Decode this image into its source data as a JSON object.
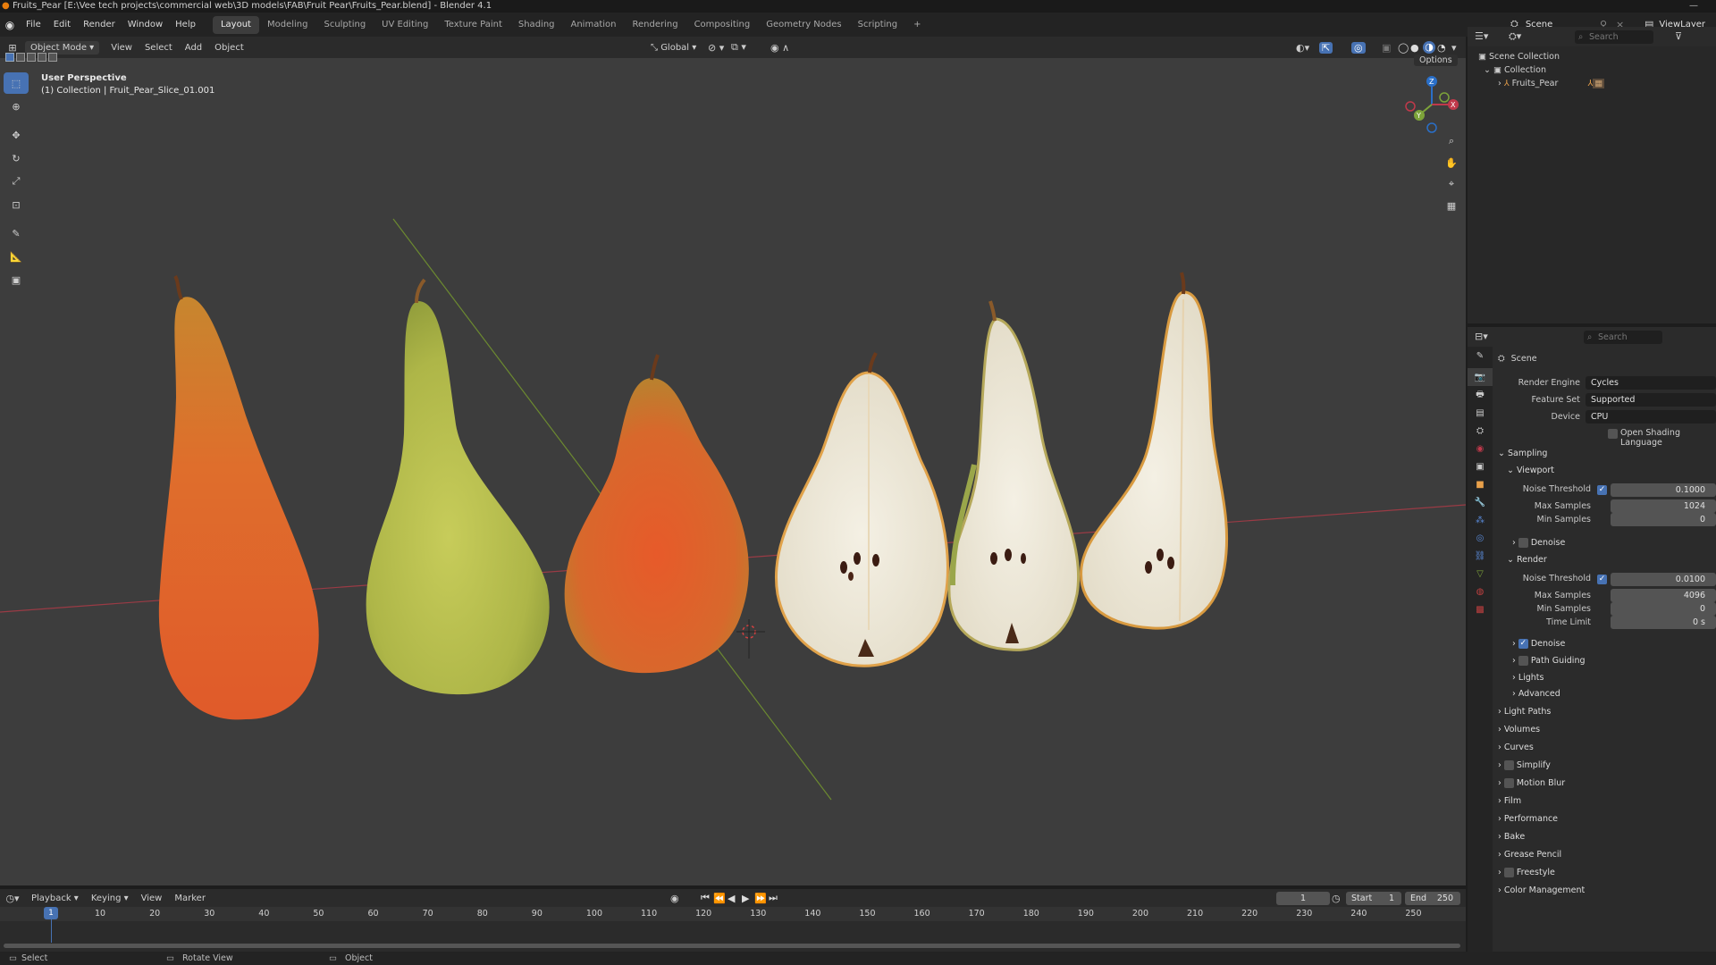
{
  "window": {
    "title": "Fruits_Pear [E:\\Vee tech projects\\commercial web\\3D models\\FAB\\Fruit Pear\\Fruits_Pear.blend] - Blender 4.1",
    "minimize": "—"
  },
  "menu": [
    "File",
    "Edit",
    "Render",
    "Window",
    "Help"
  ],
  "workspaces": [
    "Layout",
    "Modeling",
    "Sculpting",
    "UV Editing",
    "Texture Paint",
    "Shading",
    "Animation",
    "Rendering",
    "Compositing",
    "Geometry Nodes",
    "Scripting",
    "+"
  ],
  "scene": {
    "label": "Scene",
    "view_layer": "ViewLayer"
  },
  "viewport": {
    "mode": "Object Mode",
    "menus": [
      "View",
      "Select",
      "Add",
      "Object"
    ],
    "transform_orientation": "Global",
    "options": "Options",
    "perspective": "User Perspective",
    "active_object": "(1) Collection | Fruit_Pear_Slice_01.001",
    "gizmo_labels": {
      "x": "X",
      "y": "Y",
      "z": "Z"
    }
  },
  "outliner": {
    "search_placeholder": "Search",
    "items": [
      "Scene Collection",
      "Collection",
      "Fruits_Pear"
    ]
  },
  "properties": {
    "search_placeholder": "Search",
    "context": "Scene",
    "render_engine": {
      "label": "Render Engine",
      "value": "Cycles"
    },
    "feature_set": {
      "label": "Feature Set",
      "value": "Supported"
    },
    "device": {
      "label": "Device",
      "value": "CPU"
    },
    "osl": "Open Shading Language",
    "sampling": "Sampling",
    "viewport_sub": "Viewport",
    "vp_noise": {
      "label": "Noise Threshold",
      "value": "0.1000"
    },
    "vp_max": {
      "label": "Max Samples",
      "value": "1024"
    },
    "vp_min": {
      "label": "Min Samples",
      "value": "0"
    },
    "vp_denoise": "Denoise",
    "render_sub": "Render",
    "r_noise": {
      "label": "Noise Threshold",
      "value": "0.0100"
    },
    "r_max": {
      "label": "Max Samples",
      "value": "4096"
    },
    "r_min": {
      "label": "Min Samples",
      "value": "0"
    },
    "r_time": {
      "label": "Time Limit",
      "value": "0 s"
    },
    "r_denoise": "Denoise",
    "path_guiding": "Path Guiding",
    "lights": "Lights",
    "advanced": "Advanced",
    "panels": [
      "Light Paths",
      "Volumes",
      "Curves",
      "Simplify",
      "Motion Blur",
      "Film",
      "Performance",
      "Bake",
      "Grease Pencil",
      "Freestyle",
      "Color Management"
    ]
  },
  "timeline": {
    "menus": [
      "Playback",
      "Keying",
      "View",
      "Marker"
    ],
    "current_frame": "1",
    "start_label": "Start",
    "start": "1",
    "end_label": "End",
    "end": "250",
    "ticks": [
      "1",
      "10",
      "20",
      "30",
      "40",
      "50",
      "60",
      "70",
      "80",
      "90",
      "100",
      "110",
      "120",
      "130",
      "140",
      "150",
      "160",
      "170",
      "180",
      "190",
      "200",
      "210",
      "220",
      "230",
      "240",
      "250"
    ]
  },
  "status": {
    "select": "Select",
    "rotate": "Rotate View",
    "object": "Object"
  },
  "colors": {
    "accent": "#4772b3",
    "viewport_bg": "#3d3d3d",
    "x_axis": "#c0394b",
    "y_axis": "#7da33a"
  }
}
